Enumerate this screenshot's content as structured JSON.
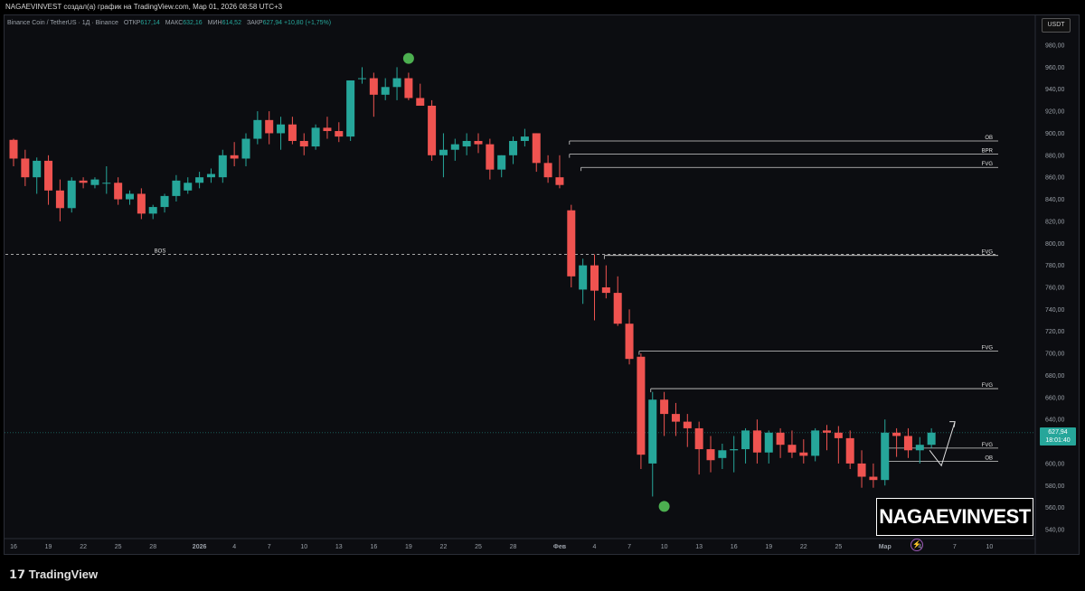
{
  "header": {
    "attribution": "NAGAEVINVEST создал(а) график на TradingView.com, Мар 01, 2026 08:58 UTC+3"
  },
  "legend": {
    "symbol": "Binance Coin / TetherUS · 1Д · Binance",
    "open_label": "ОТКР",
    "open_value": "617,14",
    "high_label": "МАКС",
    "high_value": "632,16",
    "low_label": "МИН",
    "low_value": "614,52",
    "close_label": "ЗАКР",
    "close_value": "627,94",
    "change": "+10,80 (+1,75%)"
  },
  "currency_button": "USDT",
  "price_tag": {
    "price": "627,94",
    "countdown": "18:01:40"
  },
  "watermark": "NAGAEVINVEST",
  "footer": {
    "brand": "TradingView"
  },
  "colors": {
    "up": "#26a69a",
    "down": "#ef5350",
    "background": "#0c0d11",
    "marker": "#4caf50"
  },
  "chart_data": {
    "type": "candlestick",
    "y_ticks": [
      "980,00",
      "960,00",
      "940,00",
      "920,00",
      "900,00",
      "880,00",
      "860,00",
      "840,00",
      "820,00",
      "800,00",
      "780,00",
      "760,00",
      "740,00",
      "720,00",
      "700,00",
      "680,00",
      "660,00",
      "640,00",
      "620,00",
      "600,00",
      "580,00",
      "560,00",
      "540,00"
    ],
    "ylim": [
      533,
      1000
    ],
    "x_ticks": [
      {
        "label": "16",
        "i": 0
      },
      {
        "label": "19",
        "i": 3
      },
      {
        "label": "22",
        "i": 6
      },
      {
        "label": "25",
        "i": 9
      },
      {
        "label": "28",
        "i": 12
      },
      {
        "label": "2026",
        "i": 16
      },
      {
        "label": "4",
        "i": 19
      },
      {
        "label": "7",
        "i": 22
      },
      {
        "label": "10",
        "i": 25
      },
      {
        "label": "13",
        "i": 28
      },
      {
        "label": "16",
        "i": 31
      },
      {
        "label": "19",
        "i": 34
      },
      {
        "label": "22",
        "i": 37
      },
      {
        "label": "25",
        "i": 40
      },
      {
        "label": "28",
        "i": 43
      },
      {
        "label": "Фев",
        "i": 47
      },
      {
        "label": "4",
        "i": 50
      },
      {
        "label": "7",
        "i": 53
      },
      {
        "label": "10",
        "i": 56
      },
      {
        "label": "13",
        "i": 59
      },
      {
        "label": "16",
        "i": 62
      },
      {
        "label": "19",
        "i": 65
      },
      {
        "label": "22",
        "i": 68
      },
      {
        "label": "25",
        "i": 71
      },
      {
        "label": "Мар",
        "i": 75
      },
      {
        "label": "4",
        "i": 78
      },
      {
        "label": "7",
        "i": 81
      },
      {
        "label": "10",
        "i": 84
      }
    ],
    "candles": [
      [
        894,
        895,
        870,
        877
      ],
      [
        877,
        885,
        852,
        860
      ],
      [
        860,
        878,
        845,
        875
      ],
      [
        875,
        880,
        835,
        848
      ],
      [
        848,
        858,
        820,
        832
      ],
      [
        832,
        860,
        828,
        857
      ],
      [
        857,
        860,
        850,
        855
      ],
      [
        853,
        860,
        850,
        858
      ],
      [
        855,
        870,
        845,
        855
      ],
      [
        855,
        860,
        835,
        840
      ],
      [
        840,
        848,
        835,
        845
      ],
      [
        845,
        850,
        822,
        827
      ],
      [
        827,
        835,
        822,
        833
      ],
      [
        833,
        845,
        828,
        843
      ],
      [
        843,
        862,
        838,
        857
      ],
      [
        848,
        860,
        845,
        855
      ],
      [
        855,
        865,
        850,
        860
      ],
      [
        860,
        868,
        855,
        863
      ],
      [
        860,
        885,
        855,
        880
      ],
      [
        880,
        892,
        870,
        877
      ],
      [
        877,
        900,
        870,
        895
      ],
      [
        895,
        920,
        890,
        912
      ],
      [
        912,
        920,
        890,
        900
      ],
      [
        900,
        915,
        885,
        908
      ],
      [
        908,
        915,
        890,
        893
      ],
      [
        893,
        900,
        880,
        888
      ],
      [
        888,
        908,
        885,
        905
      ],
      [
        905,
        915,
        895,
        902
      ],
      [
        902,
        910,
        892,
        897
      ],
      [
        897,
        948,
        893,
        948
      ],
      [
        950,
        960,
        945,
        950
      ],
      [
        950,
        955,
        915,
        935
      ],
      [
        935,
        950,
        930,
        942
      ],
      [
        942,
        960,
        930,
        950
      ],
      [
        950,
        955,
        930,
        932
      ],
      [
        932,
        945,
        925,
        925
      ],
      [
        925,
        930,
        875,
        880
      ],
      [
        880,
        900,
        860,
        885
      ],
      [
        885,
        895,
        875,
        890
      ],
      [
        888,
        900,
        880,
        893
      ],
      [
        893,
        900,
        882,
        890
      ],
      [
        890,
        895,
        858,
        867
      ],
      [
        867,
        880,
        860,
        880
      ],
      [
        880,
        897,
        872,
        893
      ],
      [
        893,
        904,
        888,
        897
      ],
      [
        900,
        900,
        865,
        873
      ],
      [
        873,
        880,
        855,
        860
      ],
      [
        860,
        880,
        850,
        853
      ],
      [
        830,
        835,
        760,
        770
      ],
      [
        758,
        786,
        745,
        780
      ],
      [
        780,
        790,
        730,
        757
      ],
      [
        760,
        780,
        750,
        755
      ],
      [
        755,
        770,
        725,
        727
      ],
      [
        727,
        740,
        690,
        695
      ],
      [
        697,
        700,
        595,
        608
      ],
      [
        600,
        665,
        570,
        658
      ],
      [
        658,
        665,
        625,
        645
      ],
      [
        645,
        655,
        625,
        638
      ],
      [
        638,
        645,
        615,
        632
      ],
      [
        632,
        638,
        590,
        613
      ],
      [
        613,
        625,
        592,
        603
      ],
      [
        605,
        618,
        595,
        612
      ],
      [
        612,
        625,
        592,
        613
      ],
      [
        613,
        632,
        600,
        630
      ],
      [
        630,
        640,
        600,
        610
      ],
      [
        610,
        630,
        600,
        628
      ],
      [
        628,
        632,
        605,
        617
      ],
      [
        617,
        630,
        605,
        610
      ],
      [
        610,
        622,
        600,
        607
      ],
      [
        607,
        632,
        602,
        630
      ],
      [
        630,
        635,
        612,
        628
      ],
      [
        628,
        634,
        600,
        623
      ],
      [
        623,
        630,
        595,
        600
      ],
      [
        600,
        612,
        578,
        588
      ],
      [
        588,
        600,
        578,
        585
      ],
      [
        585,
        640,
        580,
        628
      ],
      [
        628,
        632,
        606,
        625
      ],
      [
        625,
        632,
        605,
        612
      ],
      [
        612,
        624,
        600,
        617
      ],
      [
        617,
        632,
        614,
        628
      ]
    ],
    "levels": [
      {
        "label": "OB",
        "value": 893,
        "from": 48
      },
      {
        "label": "BPR",
        "value": 881,
        "from": 48
      },
      {
        "label": "FVG",
        "value": 869,
        "from": 49
      },
      {
        "label": "BOS",
        "value": 790,
        "from": -1,
        "dashed": true
      },
      {
        "label": "FVG",
        "value": 789,
        "from": 51
      },
      {
        "label": "FVG",
        "value": 702,
        "from": 54
      },
      {
        "label": "FVG",
        "value": 668,
        "from": 55
      },
      {
        "label": "FVG",
        "value": 614,
        "from": 75
      },
      {
        "label": "OB",
        "value": 602,
        "from": 75
      }
    ],
    "markers": [
      {
        "i": 34,
        "value": 968
      },
      {
        "i": 56,
        "value": 561
      }
    ],
    "current_price": 627.94
  }
}
